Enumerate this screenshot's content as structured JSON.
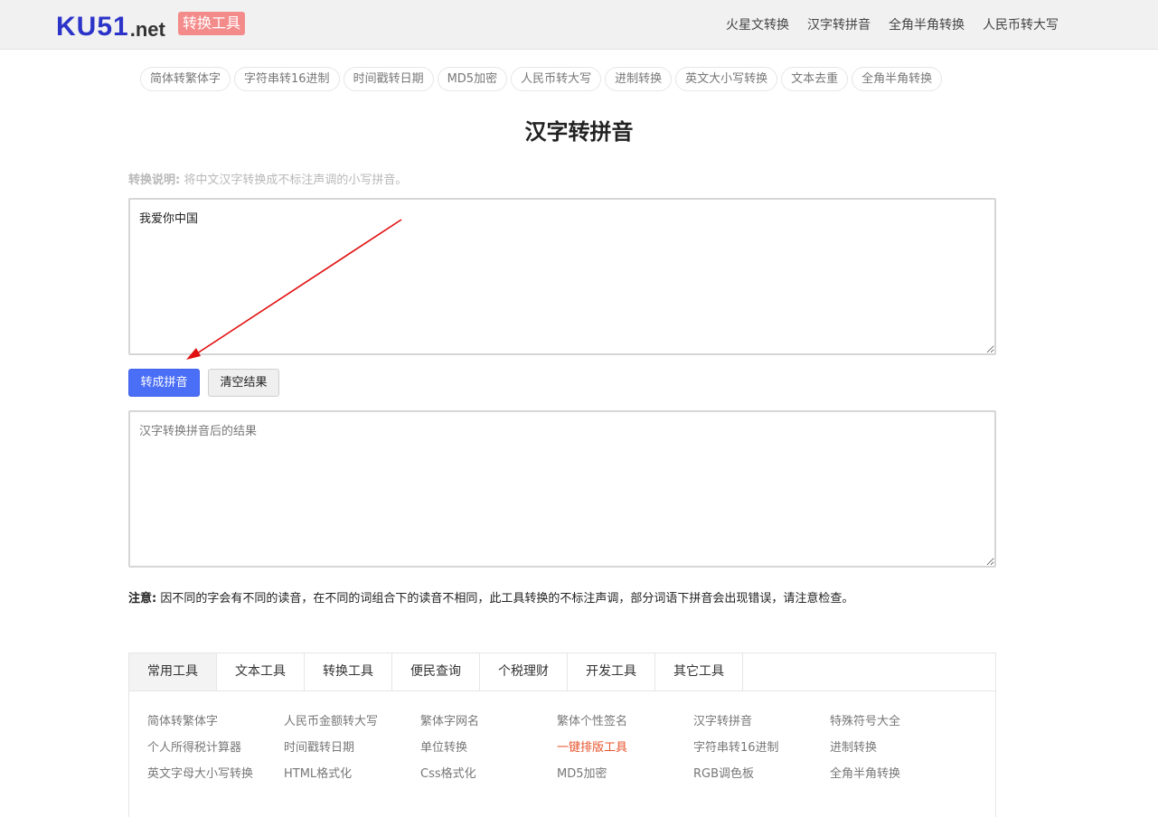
{
  "header": {
    "logo_main": "KU51",
    "logo_net": ".net",
    "badge": "转换工具",
    "nav": [
      "火星文转换",
      "汉字转拼音",
      "全角半角转换",
      "人民币转大写"
    ]
  },
  "pills": [
    "简体转繁体字",
    "字符串转16进制",
    "时间戳转日期",
    "MD5加密",
    "人民币转大写",
    "进制转换",
    "英文大小写转换",
    "文本去重",
    "全角半角转换"
  ],
  "title": "汉字转拼音",
  "description": {
    "label": "转换说明:",
    "text": "将中文汉字转换成不标注声调的小写拼音。"
  },
  "input": {
    "value": "我爱你中国"
  },
  "buttons": {
    "convert": "转成拼音",
    "clear": "清空结果"
  },
  "output": {
    "placeholder": "汉字转换拼音后的结果",
    "value": ""
  },
  "note": {
    "label": "注意:",
    "text": "因不同的字会有不同的读音，在不同的词组合下的读音不相同，此工具转换的不标注声调，部分词语下拼音会出现错误，请注意检查。"
  },
  "tools": {
    "tabs": [
      "常用工具",
      "文本工具",
      "转换工具",
      "便民查询",
      "个税理财",
      "开发工具",
      "其它工具"
    ],
    "active_tab": "常用工具",
    "links": [
      "简体转繁体字",
      "人民币金额转大写",
      "繁体字网名",
      "繁体个性签名",
      "汉字转拼音",
      "特殊符号大全",
      "个人所得税计算器",
      "时间戳转日期",
      "单位转换",
      "一键排版工具",
      "字符串转16进制",
      "进制转换",
      "英文字母大小写转换",
      "HTML格式化",
      "Css格式化",
      "MD5加密",
      "RGB调色板",
      "全角半角转换"
    ],
    "highlighted_link": "一键排版工具"
  },
  "colors": {
    "logo_blue": "#2b33c9",
    "badge_bg": "#f48b8b",
    "primary_button": "#4a6ef5",
    "highlight_link": "#e8542c",
    "annotation_arrow": "#e01010"
  }
}
